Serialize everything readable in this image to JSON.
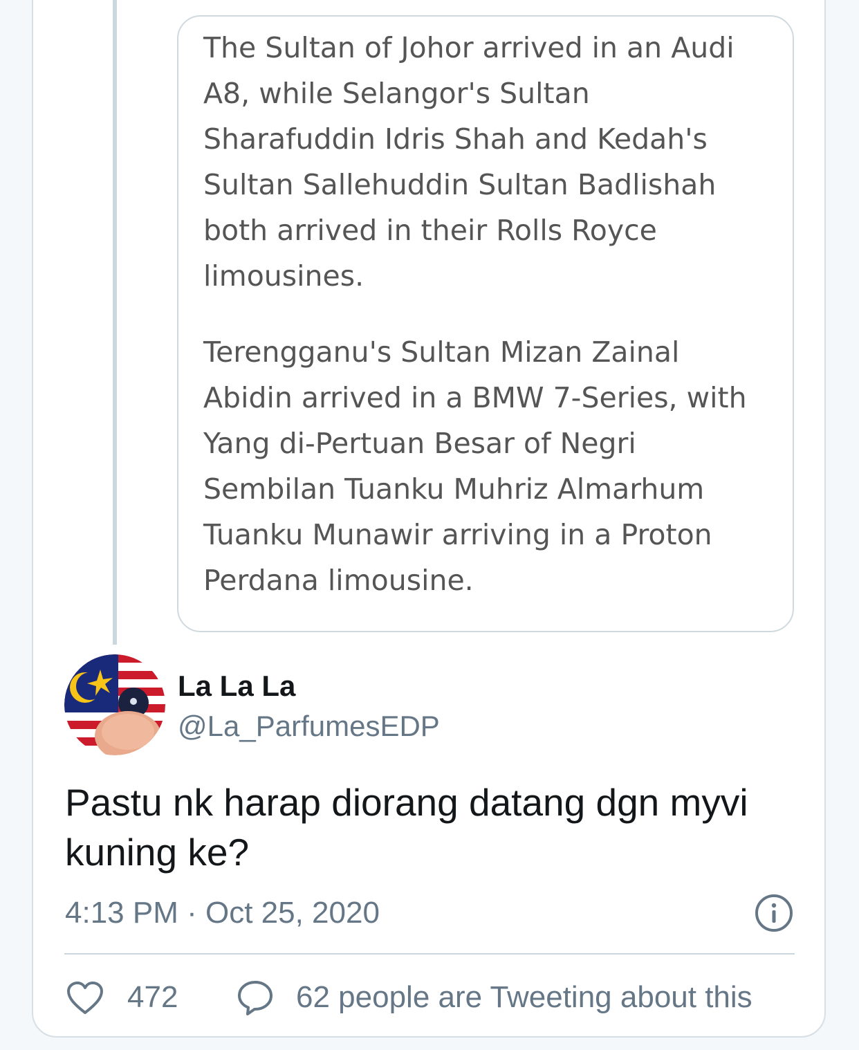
{
  "quoted_article": {
    "paragraphs": [
      "The Sultan of Johor arrived in an Audi A8, while Selangor's Sultan Sharafuddin Idris Shah and Kedah's Sultan Sallehuddin Sultan Badlishah both arrived in their Rolls Royce limousines.",
      "Terengganu's Sultan Mizan Zainal Abidin arrived in a BMW 7-Series, with Yang di-Pertuan Besar of Negri Sembilan Tuanku Muhriz Almarhum Tuanku Munawir arriving in a Proton Perdana limousine."
    ]
  },
  "author": {
    "display_name": "La La La",
    "handle": "@La_ParfumesEDP",
    "avatar_icon": "malaysian-flag-avatar"
  },
  "tweet": {
    "text": "Pastu nk harap diorang datang dgn myvi kuning ke?",
    "timestamp": "4:13 PM · Oct 25, 2020"
  },
  "actions": {
    "like_icon": "heart-icon",
    "like_count": "472",
    "reply_icon": "speech-bubble-icon",
    "tweeting_text": "62 people are Tweeting about this"
  },
  "colors": {
    "text_primary": "#14171a",
    "text_secondary": "#657786",
    "border": "#ccd6dd"
  }
}
